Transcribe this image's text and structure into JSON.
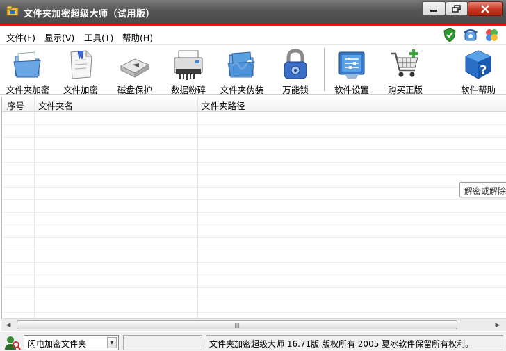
{
  "window": {
    "title": "文件夹加密超级大师（试用版）",
    "controls": {
      "minimize": "minimize",
      "maximize": "restore",
      "close": "close"
    },
    "accent_color": "#e01818"
  },
  "menu": {
    "items": [
      {
        "label": "文件(F)"
      },
      {
        "label": "显示(V)"
      },
      {
        "label": "工具(T)"
      },
      {
        "label": "帮助(H)"
      }
    ],
    "right_icons": [
      "shield-check-icon",
      "telephone-icon",
      "colorful-flower-icon"
    ]
  },
  "toolbar": {
    "buttons": [
      {
        "label": "文件夹加密",
        "icon": "folder-encrypt-icon"
      },
      {
        "label": "文件加密",
        "icon": "file-encrypt-icon"
      },
      {
        "label": "磁盘保护",
        "icon": "disk-protect-icon"
      },
      {
        "label": "数据粉碎",
        "icon": "shredder-icon"
      },
      {
        "label": "文件夹伪装",
        "icon": "folder-disguise-icon"
      },
      {
        "label": "万能锁",
        "icon": "padlock-icon"
      },
      {
        "label": "软件设置",
        "icon": "settings-icon"
      },
      {
        "label": "购买正版",
        "icon": "shopping-cart-icon"
      },
      {
        "label": "软件帮助",
        "icon": "help-cube-icon"
      }
    ]
  },
  "list": {
    "columns": [
      "序号",
      "文件夹名",
      "文件夹路径"
    ],
    "rows": []
  },
  "tooltip": {
    "text": "解密或解除"
  },
  "status": {
    "mode_select": {
      "value": "闪电加密文件夹"
    },
    "copyright": "文件夹加密超级大师 16.71版 版权所有 2005 夏冰软件保留所有权利。"
  }
}
